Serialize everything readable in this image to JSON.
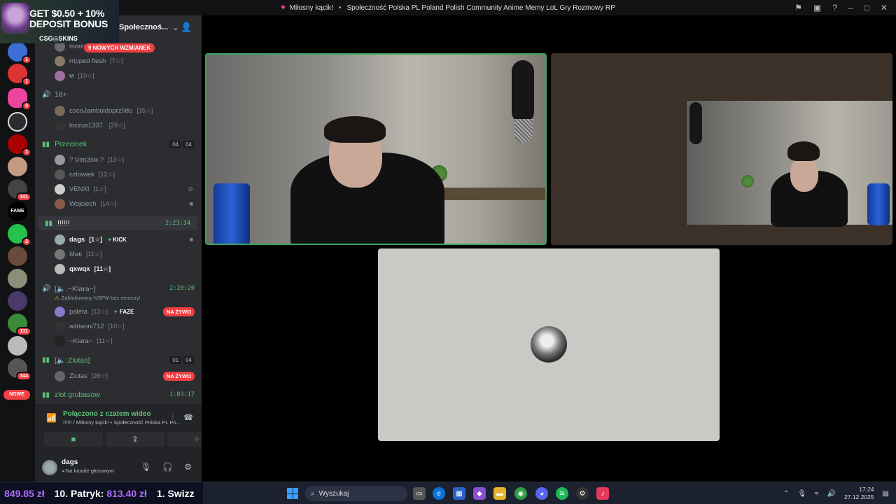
{
  "window": {
    "title_channel": "Miłosny kącik!",
    "title_sep": "•",
    "title_server": "Społeczność Polska PL Poland Polish Community Anime Memy LoL Gry Rozmowy RP"
  },
  "ad": {
    "line1": "GET $0.50 + 10%",
    "line2": "DEPOSIT BONUS",
    "brand": "CSG◎SKINS"
  },
  "rail": {
    "badges": [
      "1",
      "1",
      "9",
      "1",
      "341",
      "2",
      "131",
      "344"
    ],
    "new_label": "NOWE"
  },
  "sidebar": {
    "server_name": "Społecznoś...",
    "mention_pill": "9 NOWYCH WZMIANEK",
    "users_top": [
      {
        "name": "moon",
        "lvl": ""
      },
      {
        "name": "rripped flesh",
        "lvl": "[7☆]"
      },
      {
        "name": "м",
        "lvl": "[10☆]"
      }
    ],
    "chan_18": "18+",
    "users_18": [
      {
        "name": "cocoJamboldoprz0du",
        "lvl": "[35☆]"
      },
      {
        "name": "loczus1337.",
        "lvl": "[29☆]"
      }
    ],
    "chan_przecinek": {
      "name": "Przecinek",
      "c1": "04",
      "c2": "04"
    },
    "users_przecinek": [
      {
        "name": "? Vеη3ѕік ?",
        "lvl": "[13☆]"
      },
      {
        "name": "czlowiek",
        "lvl": "[12☆]"
      },
      {
        "name": "VENXI",
        "lvl": "[1☆]"
      },
      {
        "name": "Wojciech",
        "lvl": "[14☆]"
      }
    ],
    "chan_sel": {
      "name": "!!!!!!",
      "time": "2:23:34"
    },
    "users_sel": [
      {
        "name": "dags",
        "lvl": "[1☆]",
        "tag": "KICK"
      },
      {
        "name": "Mati",
        "lvl": "[11☆]"
      },
      {
        "name": "qxwqx",
        "lvl": "[11☆]"
      }
    ],
    "chan_klara": {
      "name": "[🔈:~Klara~]",
      "time": "2:20:20"
    },
    "klara_note": "Zablokowany NSFW bez cenzury!",
    "users_klara": [
      {
        "name": "paleta",
        "lvl": "[13☆]",
        "tag": "FAZE",
        "live": "NA ŻYWO"
      },
      {
        "name": "adrianni712",
        "lvl": "[10☆]"
      },
      {
        "name": "~Klara~",
        "lvl": "[11☆]"
      }
    ],
    "chan_ziutas": {
      "name": "[🔈:Ziutas]",
      "c1": "01",
      "c2": "04"
    },
    "users_ziutas": [
      {
        "name": "Ziutas",
        "lvl": "[28☆]",
        "live": "NA ŻYWO"
      }
    ],
    "chan_zlot": {
      "name": "zlot grubasow",
      "time": "1:03:17"
    }
  },
  "voice": {
    "status": "Połączono z czatem wideo",
    "sub": "!!!!!! / Miłosny kącik!  •  Społeczność Polska PL Po..."
  },
  "userpanel": {
    "name": "dags",
    "status": "Na kanale głosowym"
  },
  "taskbar": {
    "ticker": [
      {
        "amount": "849.85 zł",
        "label": ""
      },
      {
        "amount": "813.40 zł",
        "label": "10. Patryk:"
      },
      {
        "amount": "",
        "label": "1. Swizz"
      }
    ],
    "search_placeholder": "Wyszukaj",
    "time": "17:24",
    "date": "27.12.2025"
  },
  "colors": {
    "accent_green": "#5fbf78",
    "live_red": "#f23f43",
    "sidebar_bg": "#2b2d31"
  }
}
